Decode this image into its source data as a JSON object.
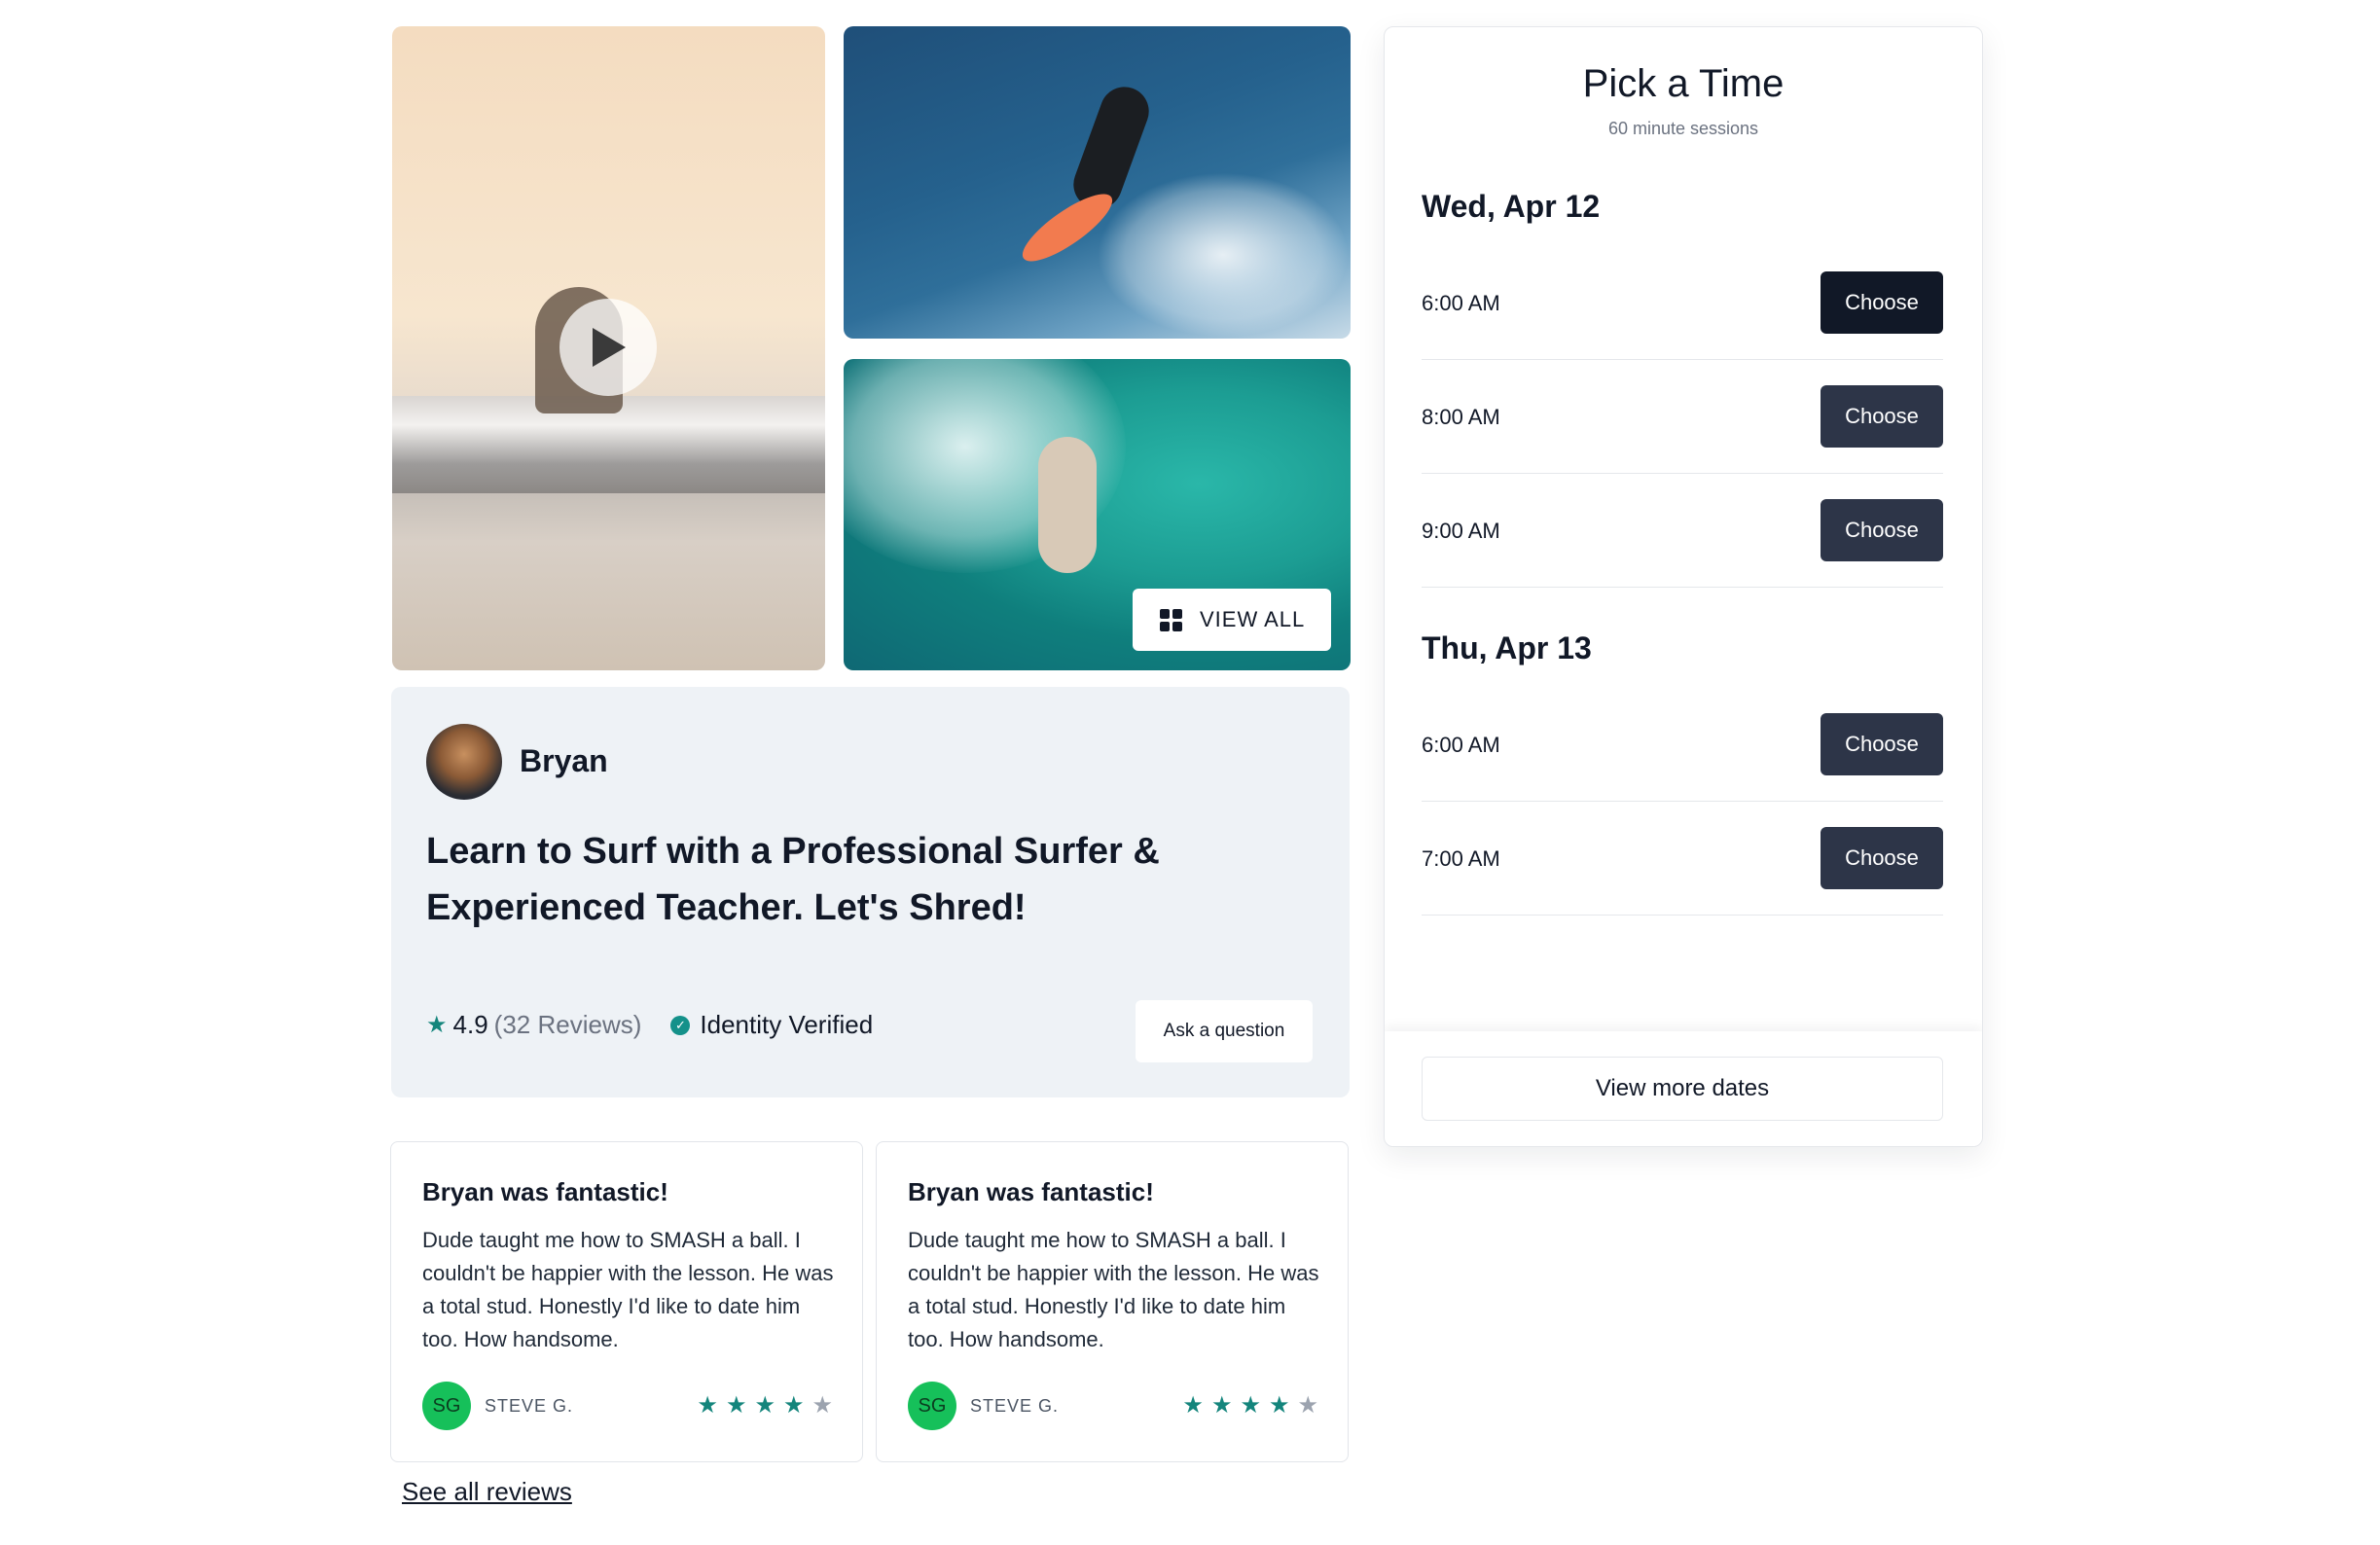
{
  "gallery": {
    "view_all_label": "VIEW ALL",
    "play_icon": "play-icon",
    "grid_icon": "grid-icon"
  },
  "host": {
    "name": "Bryan",
    "title": "Learn to Surf with a Professional Surfer & Experienced Teacher. Let's Shred!",
    "rating": "4.9",
    "reviews_count": "(32 Reviews)",
    "verified_label": "Identity Verified",
    "ask_label": "Ask a question"
  },
  "reviews": [
    {
      "title": "Bryan was fantastic!",
      "body": "Dude taught me how to SMASH a ball. I couldn't be happier with the lesson. He was a total stud. Honestly I'd like to date him too. How handsome.",
      "initials": "SG",
      "author": "STEVE G.",
      "stars": 4
    },
    {
      "title": "Bryan was fantastic!",
      "body": "Dude taught me how to SMASH a ball. I couldn't be happier with the lesson. He was a total stud. Honestly I'd like to date him too. How handsome.",
      "initials": "SG",
      "author": "STEVE G.",
      "stars": 4
    }
  ],
  "see_all_label": "See all reviews",
  "schedule": {
    "title": "Pick a Time",
    "subtitle": "60 minute sessions",
    "days": [
      {
        "label": "Wed, Apr 12",
        "slots": [
          {
            "time": "6:00 AM",
            "button": "Choose"
          },
          {
            "time": "8:00 AM",
            "button": "Choose"
          },
          {
            "time": "9:00 AM",
            "button": "Choose"
          }
        ]
      },
      {
        "label": "Thu, Apr 13",
        "slots": [
          {
            "time": "6:00 AM",
            "button": "Choose"
          },
          {
            "time": "7:00 AM",
            "button": "Choose"
          }
        ]
      }
    ],
    "more_label": "View more dates"
  },
  "colors": {
    "accent": "#14857c",
    "button_dark": "#2d3548",
    "button_active": "#111827",
    "avatar_green": "#16c05a",
    "host_card_bg": "#eef2f6"
  }
}
